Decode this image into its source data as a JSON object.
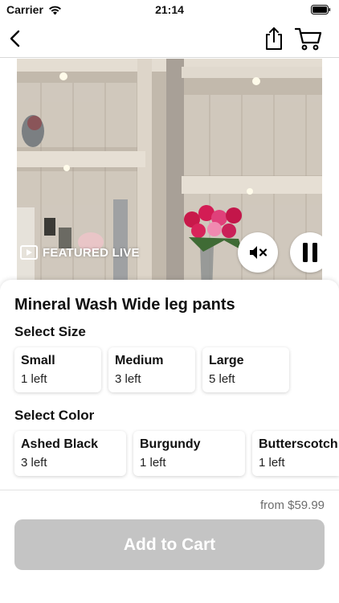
{
  "status_bar": {
    "carrier": "Carrier",
    "time": "21:14"
  },
  "nav": {
    "back_icon": "chevron-left-icon",
    "share_icon": "share-icon",
    "cart_icon": "cart-icon"
  },
  "media": {
    "featured_label": "FEATURED LIVE",
    "mute_icon": "speaker-muted-icon",
    "pause_icon": "pause-icon"
  },
  "product": {
    "title": "Mineral Wash Wide leg pants",
    "size_label": "Select Size",
    "sizes": [
      {
        "name": "Small",
        "stock": "1 left"
      },
      {
        "name": "Medium",
        "stock": "3 left"
      },
      {
        "name": "Large",
        "stock": "5 left"
      }
    ],
    "color_label": "Select Color",
    "colors": [
      {
        "name": "Ashed Black",
        "stock": "3 left"
      },
      {
        "name": "Burgundy",
        "stock": "1 left"
      },
      {
        "name": "Butterscotch",
        "stock": "1 left"
      }
    ],
    "price": "from $59.99"
  },
  "cart_button": {
    "label": "Add to Cart",
    "color": "#c4c4c4"
  }
}
